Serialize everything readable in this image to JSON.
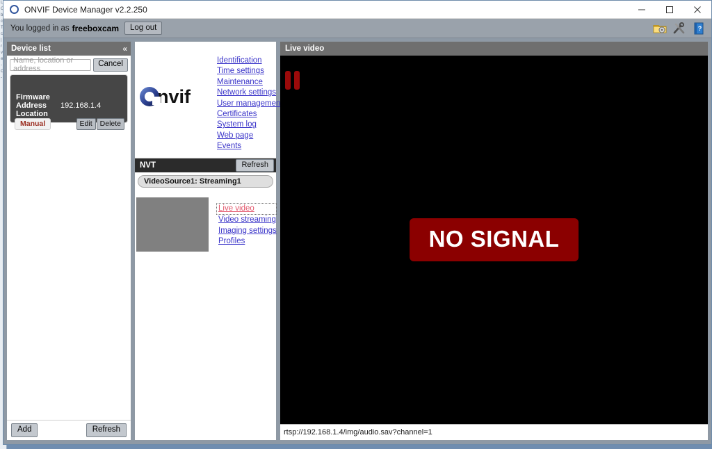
{
  "window": {
    "title": "ONVIF Device Manager v2.2.250",
    "logo_icon": "onvif-circle-icon",
    "controls": {
      "minimize": "minimize-icon",
      "maximize": "maximize-icon",
      "close": "close-icon"
    }
  },
  "toolbar": {
    "login_prefix": "You logged in as",
    "user": "freeboxcam",
    "logout_label": "Log out",
    "icons": [
      {
        "name": "folder-settings-icon"
      },
      {
        "name": "tools-icon"
      },
      {
        "name": "help-book-icon"
      }
    ]
  },
  "device_panel": {
    "title": "Device list",
    "collapse_label": "«",
    "search": {
      "value": "",
      "placeholder": "Name, location or address"
    },
    "cancel_label": "Cancel",
    "card": {
      "firmware_label": "Firmware",
      "firmware_value": "",
      "address_label": "Address",
      "address_value": "192.168.1.4",
      "location_label": "Location",
      "location_value": "",
      "badge": "Manual",
      "edit_label": "Edit",
      "delete_label": "Delete"
    },
    "footer": {
      "add_label": "Add",
      "refresh_label": "Refresh"
    }
  },
  "middle_panel": {
    "logo_wordmark": "nvif",
    "device_links": [
      {
        "label": "Identification"
      },
      {
        "label": "Time settings"
      },
      {
        "label": "Maintenance"
      },
      {
        "label": "Network settings"
      },
      {
        "label": "User management"
      },
      {
        "label": "Certificates"
      },
      {
        "label": "System log"
      },
      {
        "label": "Web page"
      },
      {
        "label": "Events"
      }
    ],
    "nvt": {
      "title": "NVT",
      "refresh_label": "Refresh",
      "profile_tab": "VideoSource1: Streaming1",
      "stream_links": [
        {
          "label": "Live video",
          "active": true
        },
        {
          "label": "Video streaming",
          "active": false
        },
        {
          "label": "Imaging settings",
          "active": false
        },
        {
          "label": "Profiles",
          "active": false
        }
      ]
    }
  },
  "video_panel": {
    "title": "Live video",
    "pause_icon": "pause-icon",
    "no_signal_text": "NO SIGNAL",
    "url": "rtsp://192.168.1.4/img/audio.sav?channel=1"
  },
  "colors": {
    "accent_link": "#3a34c9",
    "active_link": "#e2566b",
    "no_signal_bg": "#8b0000",
    "badge_text": "#9b2d20",
    "desktop": "#6f8db0"
  },
  "background_window_fragments": [
    "L",
    "C",
    "",
    "",
    "",
    "",
    "",
    "",
    "b",
    "c",
    "T",
    "",
    "",
    "",
    "",
    "c",
    "|",
    "",
    "",
    "",
    "r",
    "",
    "",
    "",
    "v",
    "e",
    "-",
    "",
    "",
    "",
    "",
    "C",
    "-"
  ]
}
